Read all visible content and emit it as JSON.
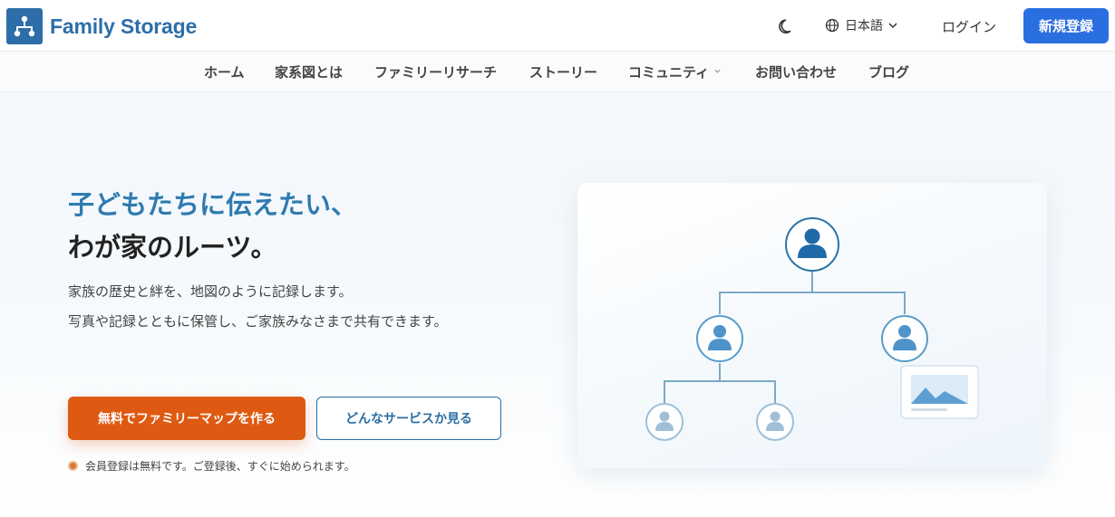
{
  "header": {
    "logo_text": "Family Storage",
    "language": "日本語",
    "login": "ログイン",
    "signup": "新規登録"
  },
  "nav": {
    "items": [
      "ホーム",
      "家系図とは",
      "ファミリーリサーチ",
      "ストーリー",
      "コミュニティ",
      "お問い合わせ",
      "ブログ"
    ]
  },
  "hero": {
    "headline_line1": "子どもたちに伝えたい、",
    "headline_line2": "わが家のルーツ。",
    "description_line1": "家族の歴史と絆を、地図のように記録します。",
    "description_line2": "写真や記録とともに保管し、ご家族みなさまで共有できます。",
    "primary_cta": "無料でファミリーマップを作る",
    "secondary_cta": "どんなサービスか見る",
    "note": "会員登録は無料です。ご登録後、すぐに始められます。"
  },
  "colors": {
    "brand": "#2d6ea9",
    "signup_button": "#2a6fe0",
    "primary_cta": "#de5a12",
    "headline_accent": "#2e7bb0"
  },
  "icons": [
    "family-tree-logo-icon",
    "moon-icon",
    "globe-icon",
    "chevron-down-icon",
    "person-icon",
    "photo-icon"
  ]
}
